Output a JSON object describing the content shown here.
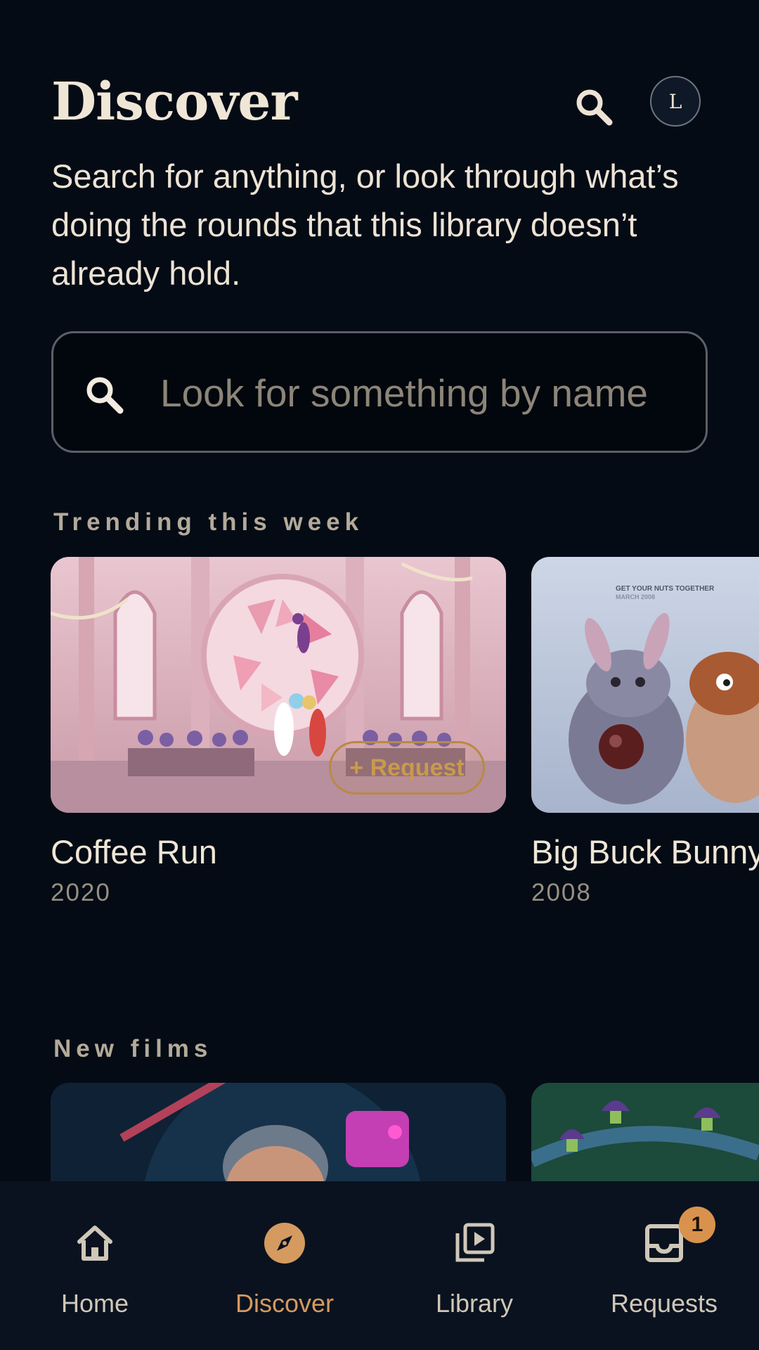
{
  "header": {
    "title": "Discover",
    "avatar_initial": "L"
  },
  "intro_text": "Search for anything, or look through what’s doing the rounds that this library doesn’t already hold.",
  "search": {
    "placeholder": "Look for something by name",
    "value": ""
  },
  "sections": {
    "trending": {
      "label": "Trending this week",
      "items": [
        {
          "title": "Coffee Run",
          "year": "2020",
          "action_label": "+ Request"
        },
        {
          "title": "Big Buck Bunny",
          "year": "2008",
          "poster_text_1": "GET YOUR NUTS TOGETHER",
          "poster_text_2": "MARCH 2008"
        }
      ]
    },
    "new_films": {
      "label": "New films"
    }
  },
  "nav": {
    "items": [
      {
        "label": "Home",
        "icon": "home-icon"
      },
      {
        "label": "Discover",
        "icon": "compass-icon",
        "active": true
      },
      {
        "label": "Library",
        "icon": "library-play-icon"
      },
      {
        "label": "Requests",
        "icon": "inbox-icon",
        "badge": "1"
      }
    ]
  },
  "colors": {
    "background": "#050b15",
    "accent": "#d59a5f",
    "text": "#ece3d4",
    "muted": "#968f82"
  }
}
